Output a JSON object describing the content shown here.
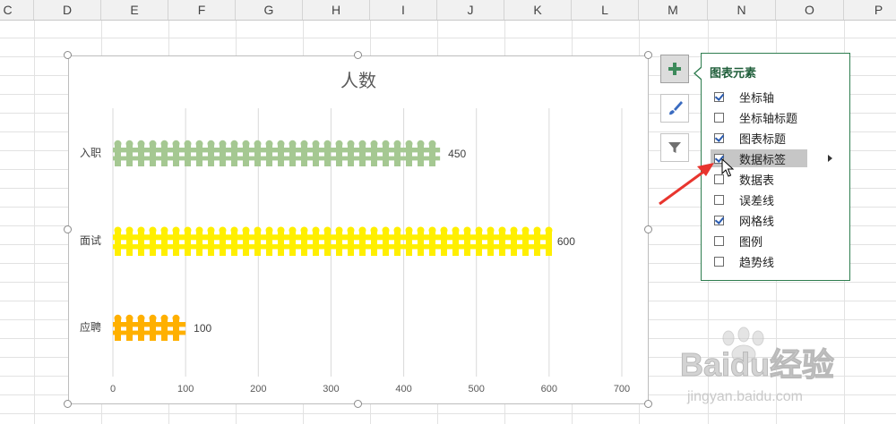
{
  "sheet": {
    "columns": [
      "C",
      "D",
      "E",
      "F",
      "G",
      "H",
      "I",
      "J",
      "K",
      "L",
      "M",
      "N",
      "O",
      "P"
    ]
  },
  "chart_data": {
    "type": "bar",
    "title": "人数",
    "categories": [
      "入职",
      "面试",
      "应聘"
    ],
    "values": [
      450,
      600,
      100
    ],
    "data_labels": [
      "450",
      "600",
      "100"
    ],
    "bar_colors": [
      "#a5c892",
      "#ffef00",
      "#ffb000"
    ],
    "bar_style": "picket-fence pictograph",
    "xlim": [
      0,
      700
    ],
    "x_ticks": [
      "0",
      "100",
      "200",
      "300",
      "400",
      "500",
      "600",
      "700"
    ],
    "orientation": "horizontal",
    "grid": true,
    "legend": "none",
    "xlabel": "",
    "ylabel": ""
  },
  "chart_tools": {
    "elements_button": {
      "icon": "plus-icon"
    },
    "styles_button": {
      "icon": "paintbrush-icon"
    },
    "filters_button": {
      "icon": "filter-icon"
    }
  },
  "elements_panel": {
    "title": "图表元素",
    "options": [
      {
        "label": "坐标轴",
        "checked": true
      },
      {
        "label": "坐标轴标题",
        "checked": false
      },
      {
        "label": "图表标题",
        "checked": true
      },
      {
        "label": "数据标签",
        "checked": true,
        "highlighted": true,
        "has_submenu": true
      },
      {
        "label": "数据表",
        "checked": false
      },
      {
        "label": "误差线",
        "checked": false
      },
      {
        "label": "网格线",
        "checked": true
      },
      {
        "label": "图例",
        "checked": false
      },
      {
        "label": "趋势线",
        "checked": false
      }
    ]
  },
  "watermark": {
    "brand": "Baidu经验",
    "url": "jingyan.baidu.com"
  },
  "colors": {
    "accent": "#2e7d4f",
    "annotation_arrow": "#e8352e",
    "gridline": "#d9d9d9"
  }
}
